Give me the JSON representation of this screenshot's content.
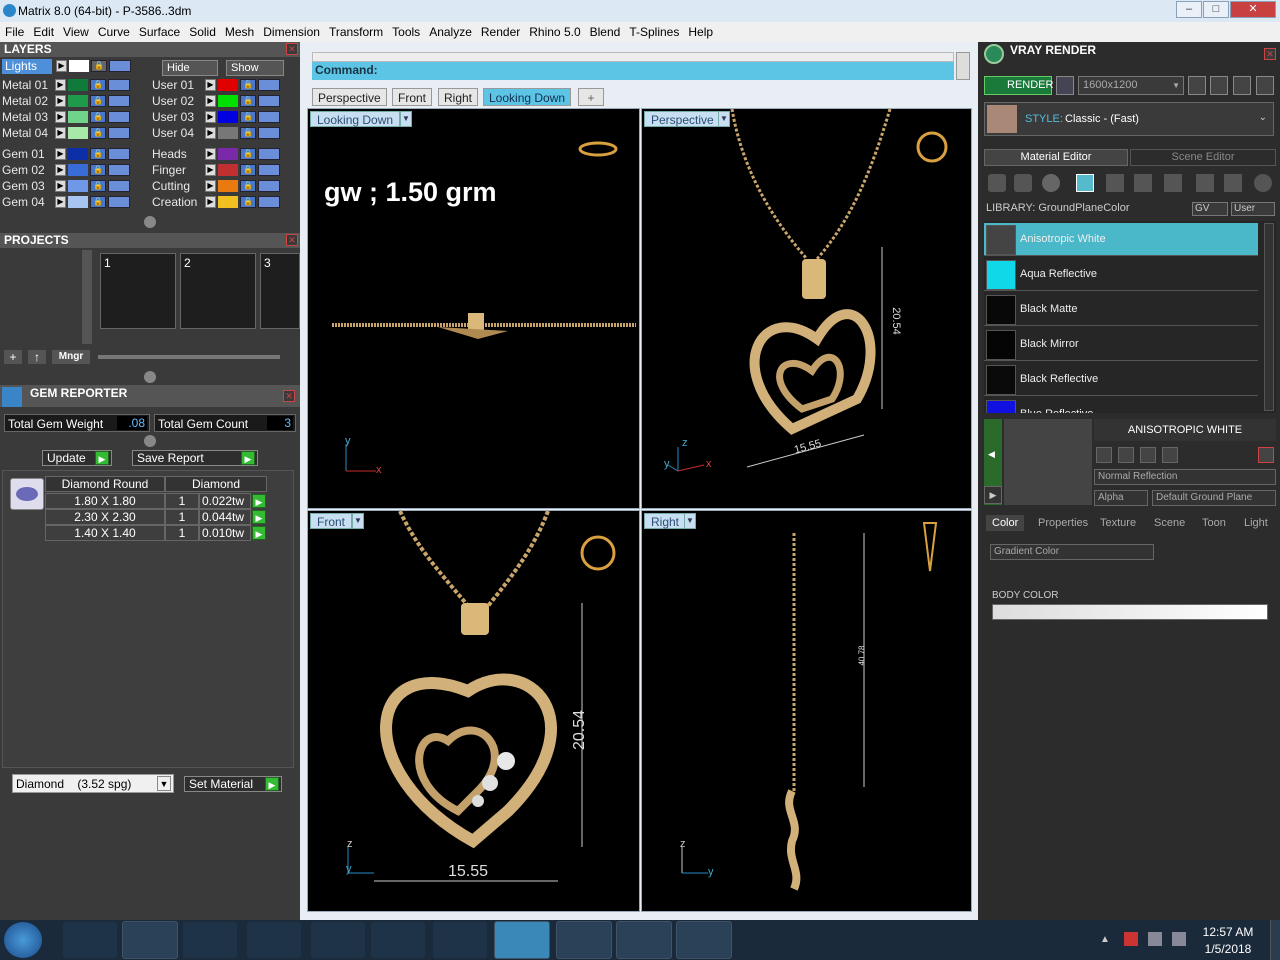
{
  "window": {
    "title": "Matrix 8.0 (64-bit) - P-3586..3dm"
  },
  "menu": [
    "File",
    "Edit",
    "View",
    "Curve",
    "Surface",
    "Solid",
    "Mesh",
    "Dimension",
    "Transform",
    "Tools",
    "Analyze",
    "Render",
    "Rhino 5.0",
    "Blend",
    "T-Splines",
    "Help"
  ],
  "layers": {
    "title": "LAYERS",
    "lights": "Lights",
    "hide": "Hide",
    "show": "Show",
    "left": [
      {
        "name": "Metal 01",
        "color": "#0f7a3a"
      },
      {
        "name": "Metal 02",
        "color": "#1f9a4a"
      },
      {
        "name": "Metal 03",
        "color": "#6fd48a"
      },
      {
        "name": "Metal 04",
        "color": "#a8e8a8"
      },
      {
        "name": "Gem 01",
        "color": "#0c2fa8"
      },
      {
        "name": "Gem 02",
        "color": "#3a6cd8"
      },
      {
        "name": "Gem 03",
        "color": "#6f98e8"
      },
      {
        "name": "Gem 04",
        "color": "#a8c4f0"
      }
    ],
    "right": [
      {
        "name": "User 01",
        "color": "#e00000"
      },
      {
        "name": "User 02",
        "color": "#00e000"
      },
      {
        "name": "User 03",
        "color": "#0000e0"
      },
      {
        "name": "User 04",
        "color": "#777777"
      },
      {
        "name": "Heads",
        "color": "#7a2aa8"
      },
      {
        "name": "Finger",
        "color": "#c03030"
      },
      {
        "name": "Cutting",
        "color": "#e87a10"
      },
      {
        "name": "Creation",
        "color": "#f0c020"
      }
    ]
  },
  "projects": {
    "title": "PROJECTS",
    "slots": [
      "1",
      "2",
      "3"
    ],
    "mngr": "Mngr"
  },
  "gem": {
    "title": "GEM REPORTER",
    "weight_label": "Total Gem Weight",
    "weight": ".08",
    "count_label": "Total Gem Count",
    "count": "3",
    "update": "Update",
    "save": "Save Report",
    "headers": [
      "Diamond Round",
      "Diamond"
    ],
    "rows": [
      {
        "size": "1.80 X 1.80",
        "qty": "1",
        "wt": "0.022tw"
      },
      {
        "size": "2.30 X 2.30",
        "qty": "1",
        "wt": "0.044tw"
      },
      {
        "size": "1.40 X 1.40",
        "qty": "1",
        "wt": "0.010tw"
      }
    ],
    "material": "Diamond    (3.52 spg)",
    "set_material": "Set Material"
  },
  "command": {
    "label": "Command:"
  },
  "view_tabs": [
    "Perspective",
    "Front",
    "Right",
    "Looking Down"
  ],
  "add_tab": "+",
  "viewports": {
    "top_left": {
      "label": "Looking Down",
      "note": "gw ; 1.50 grm",
      "ax1": "y",
      "ax2": "x"
    },
    "top_right": {
      "label": "Perspective",
      "dim_h": "20.54",
      "dim_w": "15.55",
      "ax1": "z",
      "ax2": "x",
      "ax3": "y"
    },
    "bottom_left": {
      "label": "Front",
      "dim_h": "20.54",
      "dim_w": "15.55",
      "ax1": "z",
      "ax2": "y"
    },
    "bottom_right": {
      "label": "Right",
      "dim": "40.78",
      "ax1": "z",
      "ax2": "y"
    }
  },
  "vray": {
    "title": "VRAY RENDER",
    "render": "RENDER",
    "resolution": "1600x1200",
    "style_label": "STYLE:",
    "style": "Classic - (Fast)",
    "tabs": [
      "Material Editor",
      "Scene Editor"
    ],
    "library_label": "LIBRARY: GroundPlaneColor",
    "gv": "GV",
    "user": "User",
    "materials": [
      {
        "name": "Anisotropic White",
        "color": "#444"
      },
      {
        "name": "Aqua Reflective",
        "color": "#10d8e8"
      },
      {
        "name": "Black Matte",
        "color": "#080808"
      },
      {
        "name": "Black Mirror",
        "color": "#050505"
      },
      {
        "name": "Black Reflective",
        "color": "#0a0a0a"
      },
      {
        "name": "Blue Reflective",
        "color": "#1010e0"
      }
    ],
    "selected_name": "ANISOTROPIC WHITE",
    "reflection": "Normal Reflection",
    "alpha": "Alpha",
    "ground": "Default Ground Plane",
    "props_tabs": [
      "Color",
      "Properties",
      "Texture",
      "Scene",
      "Toon",
      "Light"
    ],
    "gradient": "Gradient Color",
    "body_color": "BODY COLOR"
  },
  "taskbar": {
    "time": "12:57 AM",
    "date": "1/5/2018"
  }
}
